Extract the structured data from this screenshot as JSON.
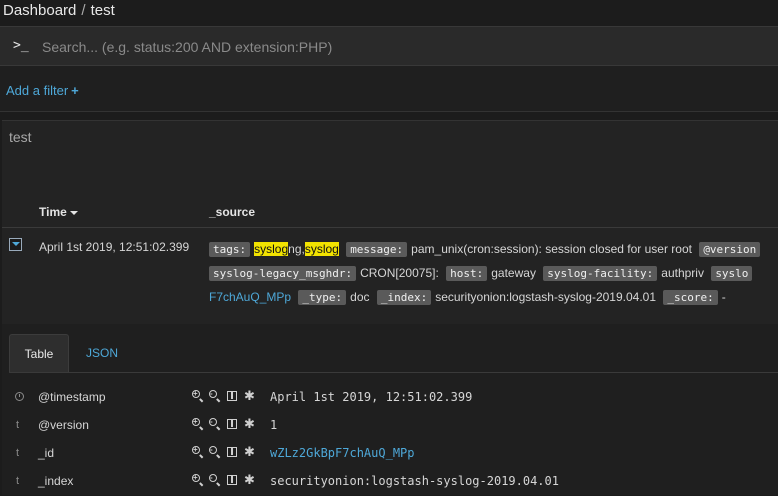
{
  "breadcrumb": {
    "parent": "Dashboard",
    "separator": "/",
    "current": "test"
  },
  "search": {
    "prompt": ">_",
    "placeholder": "Search... (e.g. status:200 AND extension:PHP)"
  },
  "filter": {
    "add_label": "Add a filter",
    "add_icon": "+"
  },
  "panel": {
    "title": "test"
  },
  "columns": {
    "time": "Time",
    "source": "_source"
  },
  "row": {
    "time": "April 1st 2019, 12:51:02.399",
    "source": {
      "tags_key": "tags:",
      "tags_hl1": "syslog",
      "tags_mid": "ng,",
      "tags_hl2": "syslog",
      "message_key": "message:",
      "message_val": "pam_unix(cron:session): session closed for user root",
      "version_key": "@version",
      "legacy_key": "syslog-legacy_msghdr:",
      "legacy_val": "CRON[20075]:",
      "host_key": "host:",
      "host_val": "gateway",
      "facility_key": "syslog-facility:",
      "facility_val": "authpriv",
      "trailing_key": "syslo",
      "id_tail": "F7chAuQ_MPp",
      "type_key": "_type:",
      "type_val": "doc",
      "index_key": "_index:",
      "index_val": "securityonion:logstash-syslog-2019.04.01",
      "score_key": "_score:",
      "score_val": "-"
    }
  },
  "detail": {
    "tabs": [
      {
        "label": "Table"
      },
      {
        "label": "JSON"
      }
    ],
    "fields": [
      {
        "type_icon": "clock-icon",
        "type_glyph": "",
        "name": "@timestamp",
        "value": "April 1st 2019, 12:51:02.399"
      },
      {
        "type_icon": "string-type-icon",
        "type_glyph": "t",
        "name": "@version",
        "value": "1"
      },
      {
        "type_icon": "string-type-icon",
        "type_glyph": "t",
        "name": "_id",
        "value": "wZLz2GkBpF7chAuQ_MPp"
      },
      {
        "type_icon": "string-type-icon",
        "type_glyph": "t",
        "name": "_index",
        "value": "securityonion:logstash-syslog-2019.04.01"
      }
    ]
  },
  "colors": {
    "accent": "#4ea8d8",
    "highlight": "#f2e300",
    "background": "#1c1c1c"
  }
}
